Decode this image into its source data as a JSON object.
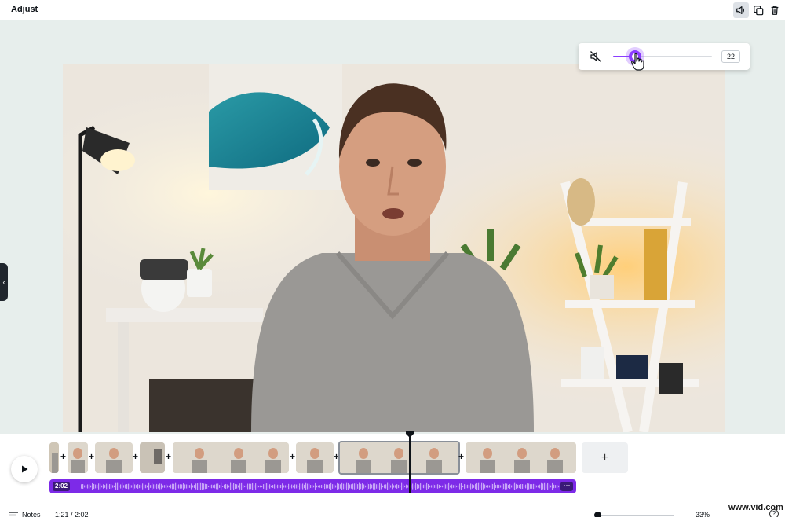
{
  "toolbar": {
    "title": "Adjust",
    "icons": [
      "volume-icon",
      "duplicate-icon",
      "trash-icon"
    ]
  },
  "volume": {
    "value": "22",
    "level_fraction": 0.22
  },
  "timeline": {
    "add_label": "+",
    "audio_duration": "2:02",
    "audio_more": "···",
    "playhead_fraction": 0.686
  },
  "bottombar": {
    "notes_label": "Notes",
    "time": "1:21 / 2:02",
    "zoom": "33%",
    "help": "?"
  },
  "watermark": "www.vid.com",
  "colors": {
    "accent": "#8b3dff",
    "audio": "#7d2ae8",
    "canvas": "#e7eeec"
  }
}
